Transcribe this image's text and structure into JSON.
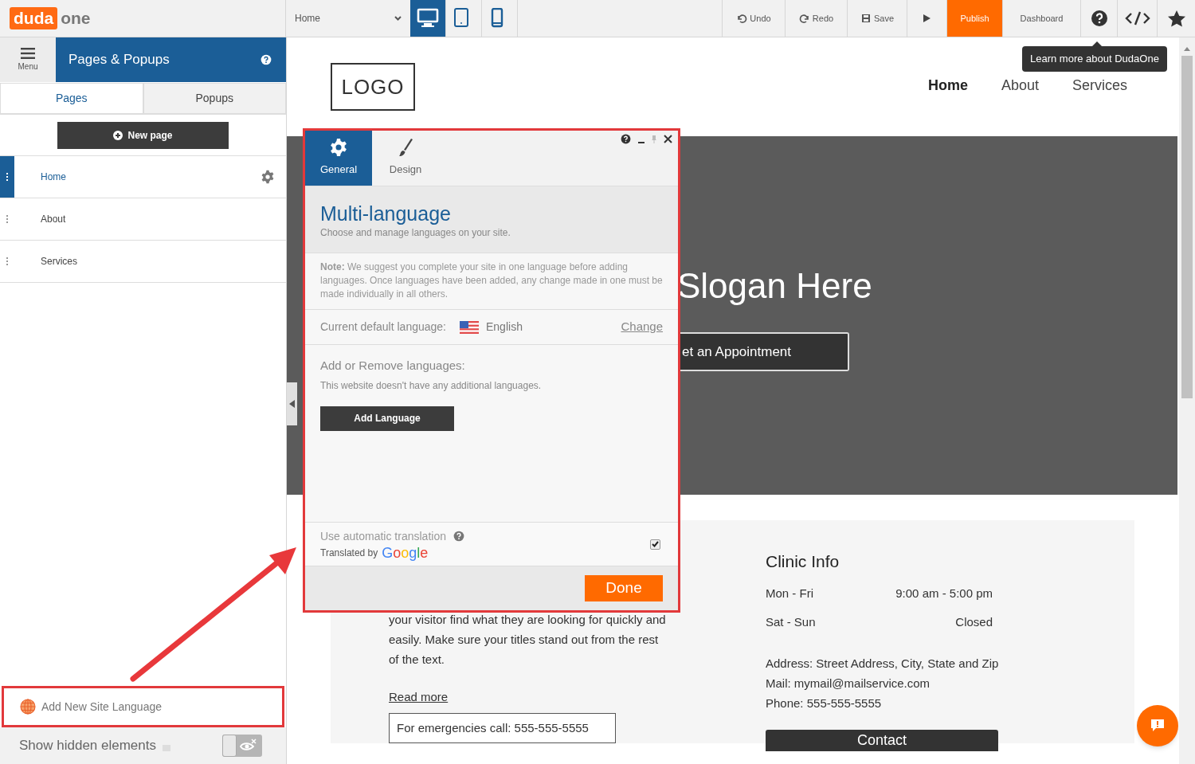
{
  "topbar": {
    "logo": {
      "word1": "duda",
      "word2": "one"
    },
    "page_select": "Home",
    "devices": [
      {
        "kind": "desktop",
        "selected": true
      },
      {
        "kind": "tablet",
        "selected": false
      },
      {
        "kind": "mobile",
        "selected": false
      }
    ],
    "actions": [
      {
        "kind": "undo",
        "label": "Undo"
      },
      {
        "kind": "redo",
        "label": "Redo"
      },
      {
        "kind": "save",
        "label": "Save"
      },
      {
        "kind": "preview"
      },
      {
        "kind": "publish",
        "label": "Publish"
      },
      {
        "kind": "dashboard",
        "label": "Dashboard"
      },
      {
        "kind": "help"
      },
      {
        "kind": "code"
      },
      {
        "kind": "star"
      }
    ],
    "tooltip": "Learn more about DudaOne"
  },
  "sidebar": {
    "menu_label": "Menu",
    "title": "Pages & Popups",
    "tabs": [
      {
        "label": "Pages",
        "selected": true
      },
      {
        "label": "Popups",
        "selected": false
      }
    ],
    "new_page": "New page",
    "pages": [
      {
        "label": "Home",
        "selected": true
      },
      {
        "label": "About",
        "selected": false
      },
      {
        "label": "Services",
        "selected": false
      }
    ],
    "add_language": "Add New Site Language",
    "show_hidden": {
      "label": "Show hidden elements",
      "on": false
    }
  },
  "site": {
    "logo": "LOGO",
    "nav": [
      {
        "label": "Home",
        "selected": true
      },
      {
        "label": "About",
        "selected": false
      },
      {
        "label": "Services",
        "selected": false
      }
    ],
    "hero": {
      "slogan": "Slogan Here",
      "button": "et an Appointment"
    },
    "intro": "your visitor find what they are looking for quickly and easily. Make sure your titles stand out from the rest of the text.",
    "read_more": "Read more",
    "emergency": "For emergencies call: 555-555-5555",
    "clinic": {
      "title": "Clinic Info",
      "hours": [
        {
          "days": "Mon - Fri",
          "time": "9:00 am - 5:00 pm"
        },
        {
          "days": "Sat - Sun",
          "time": "Closed"
        }
      ],
      "contact_lines": [
        "Address: Street Address, City, State and Zip",
        "Mail: mymail@mailservice.com",
        "Phone: 555-555-5555"
      ],
      "button": "Contact"
    }
  },
  "popup": {
    "tabs": [
      {
        "kind": "general",
        "label": "General",
        "selected": true
      },
      {
        "kind": "design",
        "label": "Design",
        "selected": false
      }
    ],
    "title": "Multi-language",
    "subtitle": "Choose and manage languages on your site.",
    "note": "**Note:** We suggest you complete your site in one language before adding languages. Once languages have been added, any change made in one must be made individually in all others.",
    "default_language": {
      "label": "Current default language:",
      "language": "English",
      "change": "Change"
    },
    "add_remove": {
      "title": "Add or Remove languages:",
      "empty": "This website doesn't have any additional languages.",
      "button": "Add Language"
    },
    "auto_translation": {
      "label": "Use automatic translation",
      "credit": "Translated by",
      "provider": "Google",
      "checked": true
    },
    "done": "Done"
  }
}
